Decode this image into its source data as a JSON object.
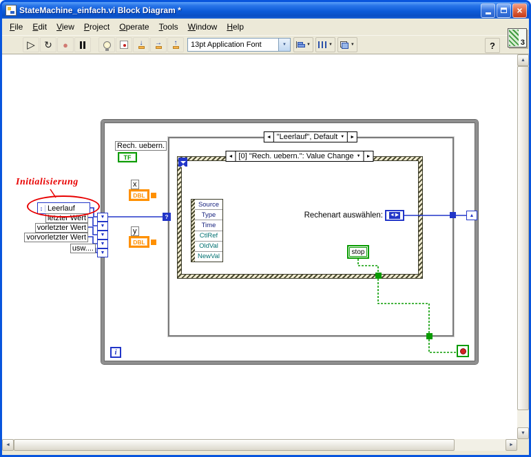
{
  "window": {
    "title": "StateMachine_einfach.vi Block Diagram *",
    "close_glyph": "×",
    "vi_icon_label": "3"
  },
  "menubar": {
    "items": [
      "File",
      "Edit",
      "View",
      "Project",
      "Operate",
      "Tools",
      "Window",
      "Help"
    ]
  },
  "toolbar": {
    "font_selector": "13pt Application Font",
    "help_label": "?"
  },
  "icons": {
    "run": "▷",
    "run_continuous": "↻",
    "abort": "●",
    "step_into": "↓",
    "step_over": "→",
    "step_out": "↑",
    "dropdown": "▼",
    "combo_arrow": "▼",
    "arrow_left": "◄",
    "arrow_right": "►",
    "ring_glyph": "◄▶",
    "enum_updown": "↕",
    "selector_glyph": "?",
    "sr_up": "▲",
    "sr_down": "▼",
    "scroll_up": "▲",
    "scroll_down": "▼",
    "scroll_left": "◄",
    "scroll_right": "►"
  },
  "diagram": {
    "annotation": "Initialisierung",
    "enum_value": "Leerlauf",
    "free_labels": [
      "letzter Wert",
      "vorletzter Wert",
      "vorvorletzter Wert",
      "usw...."
    ],
    "rech_label": "Rech. uebern.",
    "tf_label": "TF",
    "x_label": "x",
    "y_label": "y",
    "dbl_label": "DBL",
    "case_selector": "\"Leerlauf\", Default",
    "event_selector": "[0] \"Rech. uebern.\": Value Change",
    "event_data_items": [
      "Source",
      "Type",
      "Time",
      "CtlRef",
      "OldVal",
      "NewVal"
    ],
    "ring_label": "Rechenart auswählen:",
    "stop_label": "stop",
    "iteration_label": "i"
  },
  "colors": {
    "wire_blue": "#2135c8",
    "wire_green": "#089b00",
    "dbl_orange": "#ff9000",
    "annotation_red": "#e80000",
    "structure_gray": "#8f8f8f",
    "titlebar_blue": "#0855dd"
  }
}
